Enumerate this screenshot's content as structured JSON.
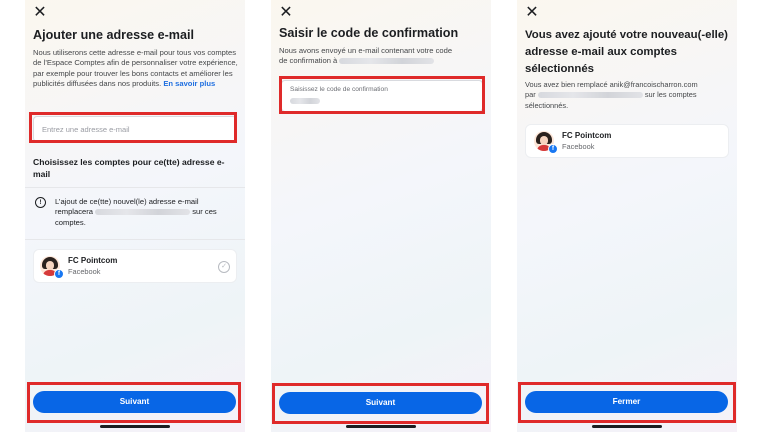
{
  "panel1": {
    "title": "Ajouter une adresse e-mail",
    "description": "Nous utiliserons cette adresse e-mail pour tous vos comptes de l’Espace Comptes afin de personnaliser votre expérience, par exemple pour trouver les bons contacts et améliorer les publicités diffusées dans nos produits.",
    "learn_more": "En savoir plus",
    "email_placeholder": "Entrez une adresse e-mail",
    "choose_accounts": "Choisissez les comptes pour ce(tte) adresse e-mail",
    "notice_line1": "L’ajout de ce(tte) nouvel(le) adresse e-mail",
    "notice_line2_prefix": "remplacera",
    "notice_line2_suffix": "sur ces",
    "notice_line3": "comptes.",
    "account_name": "FC Pointcom",
    "account_platform": "Facebook",
    "button": "Suivant"
  },
  "panel2": {
    "title": "Saisir le code de confirmation",
    "description_line1": "Nous avons envoyé un e-mail contenant votre code",
    "description_line2": "de confirmation à",
    "code_label": "Saisissez le code de confirmation",
    "button": "Suivant"
  },
  "panel3": {
    "title": "Vous avez ajouté votre nouveau(-elle) adresse e-mail aux comptes sélectionnés",
    "description_line1": "Vous avez bien remplacé anik@francoischarron.com",
    "description_line2_prefix": "par",
    "description_line2_suffix": "sur les comptes",
    "description_line3": "sélectionnés.",
    "account_name": "FC Pointcom",
    "account_platform": "Facebook",
    "button": "Fermer"
  },
  "icons": {
    "close": "close-icon",
    "info": "info-icon",
    "check": "check-circle-icon",
    "facebook": "facebook-badge-icon"
  },
  "colors": {
    "primary_button": "#0866e6",
    "highlight_frame": "#df2a2a",
    "link": "#1f6fe0"
  }
}
